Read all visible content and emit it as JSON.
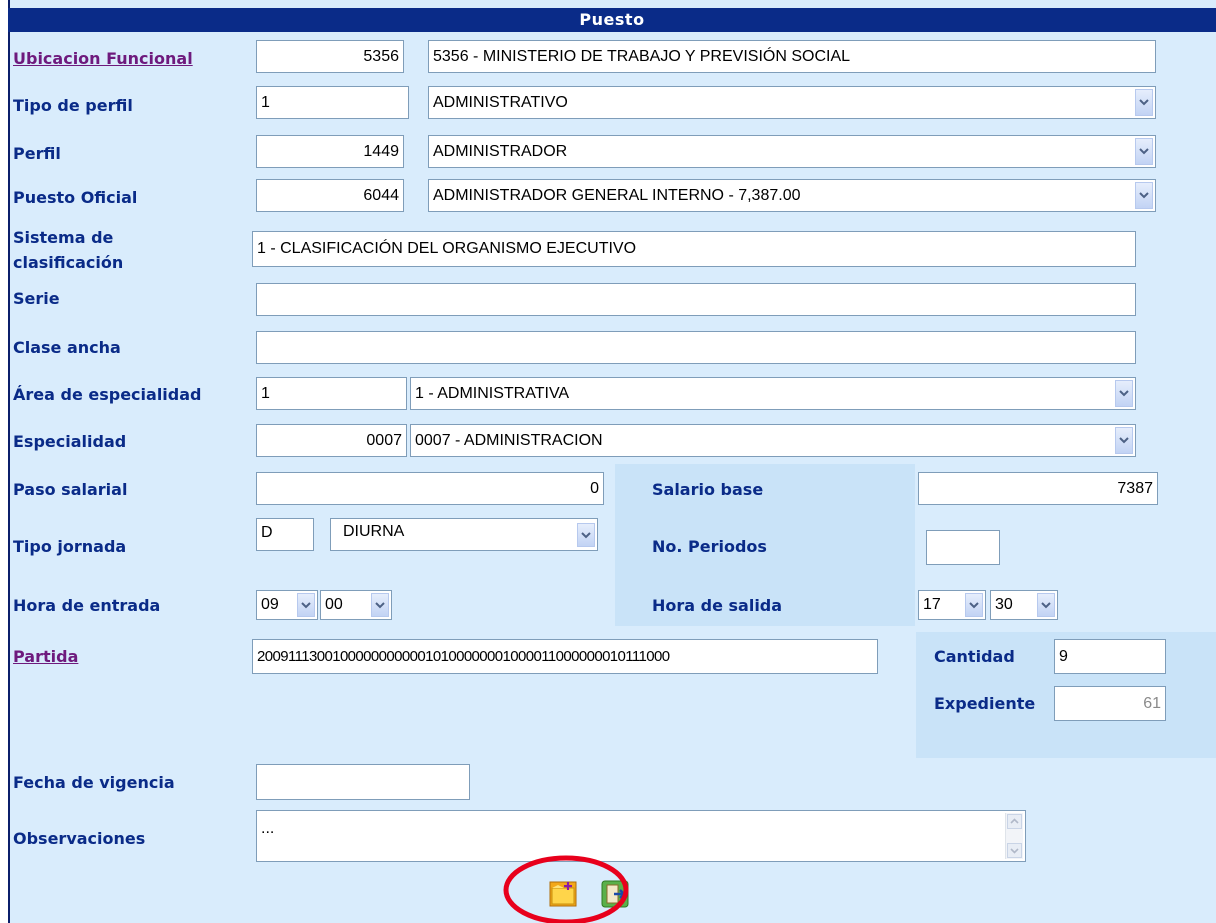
{
  "section_title": "Puesto",
  "fields": {
    "ubicacion": {
      "label": "Ubicacion Funcional",
      "code": "5356",
      "desc": "5356 - MINISTERIO DE TRABAJO Y PREVISIÓN SOCIAL"
    },
    "tipo_perfil": {
      "label": "Tipo de perfil",
      "code": "1",
      "selected": "ADMINISTRATIVO"
    },
    "perfil": {
      "label": "Perfil",
      "code": "1449",
      "selected": "ADMINISTRADOR"
    },
    "puesto_oficial": {
      "label": "Puesto Oficial",
      "code": "6044",
      "selected": "ADMINISTRADOR GENERAL INTERNO - 7,387.00"
    },
    "sistema": {
      "label_line1": "Sistema de",
      "label_line2": "clasificación",
      "value": "1 - CLASIFICACIÓN DEL ORGANISMO EJECUTIVO"
    },
    "serie": {
      "label": "Serie",
      "value": ""
    },
    "clase_ancha": {
      "label": "Clase ancha",
      "value": ""
    },
    "area": {
      "label": "Área de especialidad",
      "code": "1",
      "selected": "1 - ADMINISTRATIVA"
    },
    "especialidad": {
      "label": "Especialidad",
      "code": "0007",
      "selected": "0007 - ADMINISTRACION"
    },
    "paso_salarial": {
      "label": "Paso salarial",
      "value": "0"
    },
    "salario_base": {
      "label": "Salario base",
      "value": "7387"
    },
    "tipo_jornada": {
      "label": "Tipo jornada",
      "code": "D",
      "selected": "DIURNA"
    },
    "no_periodos": {
      "label": "No. Periodos",
      "value": ""
    },
    "hora_entrada": {
      "label": "Hora de entrada",
      "hour": "09",
      "minute": "00"
    },
    "hora_salida": {
      "label": "Hora de salida",
      "hour": "17",
      "minute": "30"
    },
    "partida": {
      "label": "Partida",
      "value": "200911130010000000000010100000001000011000000010111000"
    },
    "cantidad": {
      "label": "Cantidad",
      "value": "9"
    },
    "expediente": {
      "label": "Expediente",
      "value": "61"
    },
    "fecha_vigencia": {
      "label": "Fecha de vigencia",
      "value": ""
    },
    "observaciones": {
      "label": "Observaciones",
      "value": "..."
    }
  },
  "icons": {
    "new": "new-folder-icon",
    "exit": "exit-door-icon"
  },
  "colors": {
    "header": "#0a2b88",
    "label": "#0a2b88",
    "link": "#6e1a7d",
    "background": "#d9ecfc",
    "highlight": "#e8001c"
  }
}
